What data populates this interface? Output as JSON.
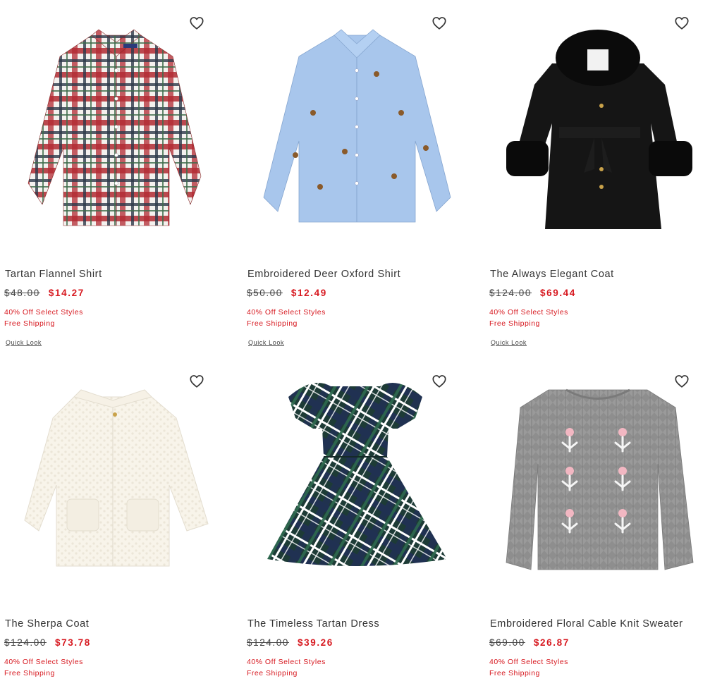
{
  "products": [
    {
      "name": "Tartan Flannel Shirt",
      "was": "$48.00",
      "now": "$14.27",
      "promo": "40% Off Select Styles",
      "shipping": "Free Shipping",
      "quick_look": "Quick Look",
      "wishlist_icon": "heart-outline-icon"
    },
    {
      "name": "Embroidered Deer Oxford Shirt",
      "was": "$50.00",
      "now": "$12.49",
      "promo": "40% Off Select Styles",
      "shipping": "Free Shipping",
      "quick_look": "Quick Look",
      "wishlist_icon": "heart-outline-icon"
    },
    {
      "name": "The Always Elegant Coat",
      "was": "$124.00",
      "now": "$69.44",
      "promo": "40% Off Select Styles",
      "shipping": "Free Shipping",
      "quick_look": "Quick Look",
      "wishlist_icon": "heart-outline-icon"
    },
    {
      "name": "The Sherpa Coat",
      "was": "$124.00",
      "now": "$73.78",
      "promo": "40% Off Select Styles",
      "shipping": "Free Shipping",
      "wishlist_icon": "heart-outline-icon"
    },
    {
      "name": "The Timeless Tartan Dress",
      "was": "$124.00",
      "now": "$39.26",
      "promo": "40% Off Select Styles",
      "shipping": "Free Shipping",
      "wishlist_icon": "heart-outline-icon"
    },
    {
      "name": "Embroidered Floral Cable Knit Sweater",
      "was": "$69.00",
      "now": "$26.87",
      "promo": "40% Off Select Styles",
      "shipping": "Free Shipping",
      "wishlist_icon": "heart-outline-icon"
    }
  ],
  "colors": {
    "sale": "#d71920",
    "text": "#333333"
  }
}
